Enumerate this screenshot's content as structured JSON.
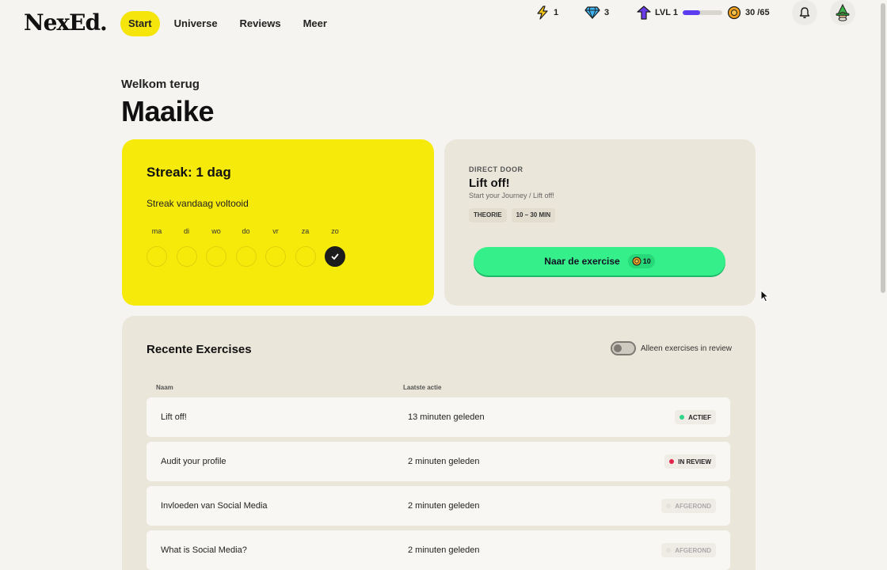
{
  "brand": {
    "logo_text": "NexEd",
    "logo_dot": "."
  },
  "nav": {
    "items": [
      {
        "label": "Start",
        "active": true
      },
      {
        "label": "Universe",
        "active": false
      },
      {
        "label": "Reviews",
        "active": false
      },
      {
        "label": "Meer",
        "active": false
      }
    ]
  },
  "stats": {
    "energy": "1",
    "gems": "3",
    "level": "LVL 1",
    "level_progress": 0.45,
    "coins": "30 /65"
  },
  "greeting": {
    "welcome": "Welkom terug",
    "name": "Maaike"
  },
  "streak": {
    "title": "Streak: 1 dag",
    "subtitle": "Streak vandaag voltooid",
    "days": [
      {
        "label": "ma",
        "done": false
      },
      {
        "label": "di",
        "done": false
      },
      {
        "label": "wo",
        "done": false
      },
      {
        "label": "do",
        "done": false
      },
      {
        "label": "vr",
        "done": false
      },
      {
        "label": "za",
        "done": false
      },
      {
        "label": "zo",
        "done": true
      }
    ]
  },
  "direct_door": {
    "kicker": "DIRECT DOOR",
    "title": "Lift off!",
    "path": "Start your Journey / Lift off!",
    "chips": [
      "THEORIE",
      "10 – 30 MIN"
    ],
    "cta_label": "Naar de exercise",
    "cta_reward": "10"
  },
  "recent": {
    "title": "Recente Exercises",
    "toggle_label": "Alleen exercises in review",
    "col_name": "Naam",
    "col_action": "Laatste actie",
    "rows": [
      {
        "name": "Lift off!",
        "time": "13 minuten geleden",
        "status": "ACTIEF",
        "status_color": "#2fd58a",
        "muted": false
      },
      {
        "name": "Audit your profile",
        "time": "2 minuten geleden",
        "status": "IN REVIEW",
        "status_color": "#e5234a",
        "muted": false
      },
      {
        "name": "Invloeden van Social Media",
        "time": "2 minuten geleden",
        "status": "AFGEROND",
        "status_color": "#e5e2dc",
        "muted": true
      },
      {
        "name": "What is Social Media?",
        "time": "2 minuten geleden",
        "status": "AFGEROND",
        "status_color": "#e5e2dc",
        "muted": true
      }
    ]
  },
  "colors": {
    "accent_yellow": "#f6ea0b",
    "cta_green": "#35f08a",
    "level_purple": "#5a3df0"
  },
  "icons": [
    "lightning-icon",
    "diamond-icon",
    "level-up-icon",
    "coin-icon",
    "bell-icon",
    "avatar-wizard-icon",
    "check-icon"
  ]
}
